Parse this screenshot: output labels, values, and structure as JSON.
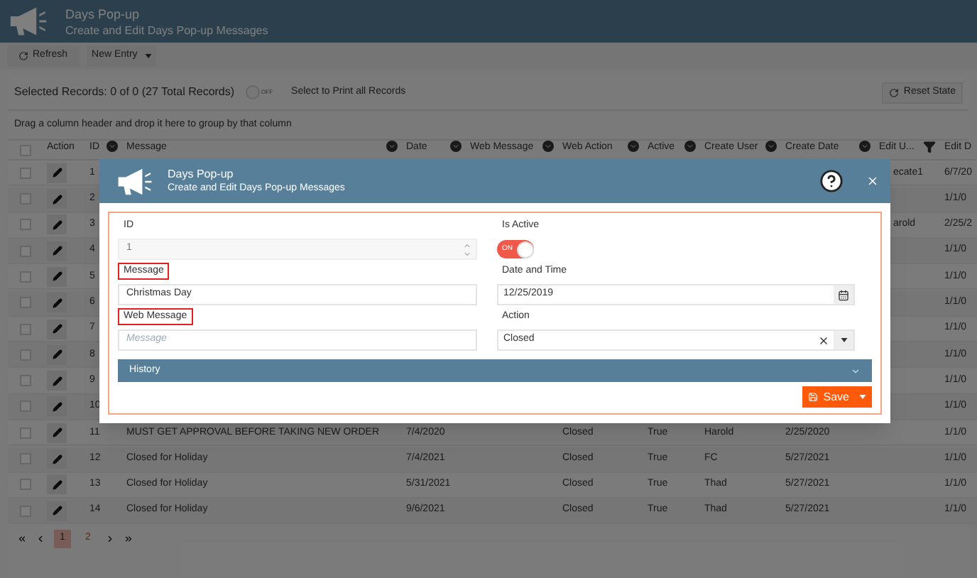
{
  "app_header": {
    "title": "Days Pop-up",
    "subtitle": "Create and Edit Days Pop-up Messages"
  },
  "toolbar": [
    {
      "kind": "refresh",
      "label": "Refresh"
    },
    {
      "kind": "split",
      "label": "New Entry"
    }
  ],
  "selection_bar": {
    "summary": "Selected Records: 0 of 0 (27 Total Records)",
    "print_toggle": {
      "on": false,
      "text": "OFF"
    },
    "print_label": "Select to Print all Records",
    "reset_button": "Reset State"
  },
  "group_hint": "Drag a column header and drop it here to group by that column",
  "table": {
    "all_checked": false,
    "columns": [
      {
        "label": "Action",
        "kind": "plain"
      },
      {
        "label": "ID",
        "kind": "sortable"
      },
      {
        "label": "Message",
        "kind": "sortable"
      },
      {
        "label": "Date",
        "kind": "sortable"
      },
      {
        "label": "Web Message",
        "kind": "sortable"
      },
      {
        "label": "Web Action",
        "kind": "sortable"
      },
      {
        "label": "Active",
        "kind": "sortable"
      },
      {
        "label": "Create User",
        "kind": "sortable"
      },
      {
        "label": "Create Date",
        "kind": "sortable"
      },
      {
        "label": "Edit U...",
        "kind": "filter"
      },
      {
        "label": "Edit D",
        "kind": "plain"
      }
    ],
    "rows": [
      {
        "checked": false,
        "id": "1",
        "edit_user": "ecate1",
        "edit_date": "6/7/20"
      },
      {
        "checked": false,
        "id": "2",
        "edit_date": "1/1/0"
      },
      {
        "checked": false,
        "id": "3",
        "edit_user": "arold",
        "edit_date": "2/25/2"
      },
      {
        "checked": false,
        "id": "4",
        "edit_date": "1/1/0"
      },
      {
        "checked": false,
        "id": "5",
        "edit_date": "1/1/0"
      },
      {
        "checked": false,
        "id": "6",
        "edit_date": "1/1/0"
      },
      {
        "checked": false,
        "id": "7",
        "edit_date": "1/1/0"
      },
      {
        "checked": false,
        "id": "8",
        "edit_date": "1/1/0"
      },
      {
        "checked": false,
        "id": "9",
        "edit_date": "1/1/0"
      },
      {
        "checked": false,
        "id": "10",
        "edit_date": "1/1/0"
      },
      {
        "checked": false,
        "id": "11",
        "message": "MUST GET APPROVAL BEFORE TAKING NEW ORDER",
        "date": "7/4/2020",
        "web_action": "Closed",
        "active": "True",
        "create_user": "Harold",
        "create_date": "2/25/2020",
        "edit_date": "1/1/0"
      },
      {
        "checked": false,
        "id": "12",
        "message": "Closed for Holiday",
        "date": "7/4/2021",
        "web_action": "Closed",
        "active": "True",
        "create_user": "FC",
        "create_date": "5/27/2021",
        "edit_date": "1/1/0"
      },
      {
        "checked": false,
        "id": "13",
        "message": "Closed for Holiday",
        "date": "5/31/2021",
        "web_action": "Closed",
        "active": "True",
        "create_user": "Thad",
        "create_date": "5/27/2021",
        "edit_date": "1/1/0"
      },
      {
        "checked": false,
        "id": "14",
        "message": "Closed for Holiday",
        "date": "9/6/2021",
        "web_action": "Closed",
        "active": "True",
        "create_user": "Thad",
        "create_date": "5/27/2021",
        "edit_date": "1/1/0"
      }
    ]
  },
  "pagination": [
    {
      "label": "1",
      "selected": true
    },
    {
      "label": "2",
      "selected": false
    }
  ],
  "dialog": {
    "title": "Days Pop-up",
    "subtitle": "Create and Edit Days Pop-up Messages",
    "fields": [
      {
        "kind": "number",
        "label": "ID",
        "value": "1",
        "highlighted": false
      },
      {
        "kind": "toggle",
        "label": "Is Active",
        "on": true,
        "text": "ON",
        "highlighted": false
      },
      {
        "kind": "text",
        "label": "Message",
        "value": "Christmas Day",
        "highlighted": true
      },
      {
        "kind": "date",
        "label": "Date and Time",
        "value": "12/25/2019",
        "highlighted": false
      },
      {
        "kind": "text",
        "label": "Web Message",
        "placeholder": "Message",
        "highlighted": true
      },
      {
        "kind": "select",
        "label": "Action",
        "value": "Closed",
        "highlighted": false
      }
    ],
    "section": {
      "label": "History",
      "expanded": false
    },
    "save_button": "Save"
  }
}
